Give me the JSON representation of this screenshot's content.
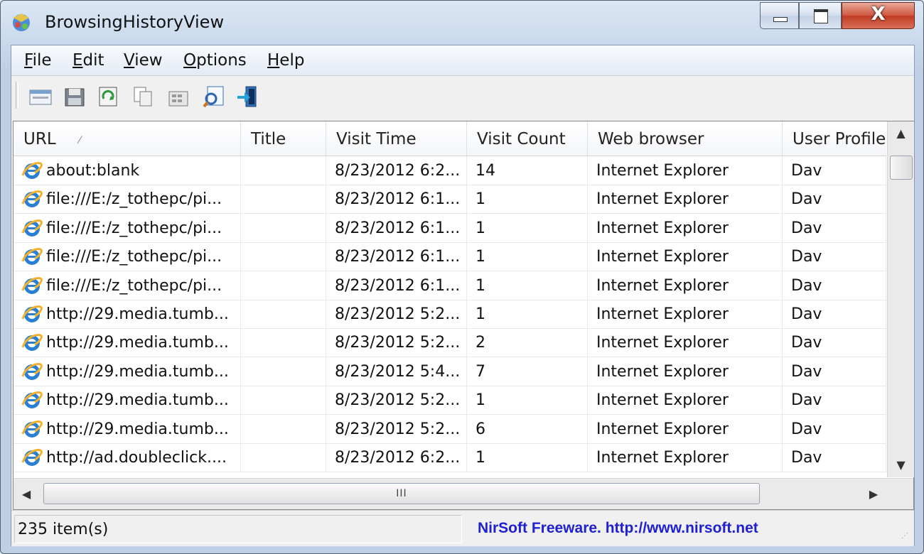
{
  "window": {
    "title": "BrowsingHistoryView",
    "controls": {
      "minimize": "minimize",
      "maximize": "maximize",
      "close": "X"
    }
  },
  "menu": [
    {
      "label": "File",
      "accel": "F",
      "rest": "ile"
    },
    {
      "label": "Edit",
      "accel": "E",
      "rest": "dit"
    },
    {
      "label": "View",
      "accel": "V",
      "rest": "iew"
    },
    {
      "label": "Options",
      "accel": "O",
      "rest": "ptions"
    },
    {
      "label": "Help",
      "accel": "H",
      "rest": "elp"
    }
  ],
  "toolbar": {
    "buttons": [
      {
        "icon": "advanced-options-icon"
      },
      {
        "icon": "save-icon"
      },
      {
        "icon": "refresh-icon"
      },
      {
        "icon": "copy-icon"
      },
      {
        "icon": "properties-icon"
      },
      {
        "icon": "find-icon"
      },
      {
        "icon": "exit-icon"
      }
    ]
  },
  "columns": [
    "URL",
    "Title",
    "Visit Time",
    "Visit Count",
    "Web browser",
    "User Profile"
  ],
  "rows": [
    {
      "url": "about:blank",
      "title": "",
      "visit_time": "8/23/2012 6:2...",
      "visit_count": "14",
      "browser": "Internet Explorer",
      "profile": "Dav"
    },
    {
      "url": "file:///E:/z_tothepc/pi...",
      "title": "",
      "visit_time": "8/23/2012 6:1...",
      "visit_count": "1",
      "browser": "Internet Explorer",
      "profile": "Dav"
    },
    {
      "url": "file:///E:/z_tothepc/pi...",
      "title": "",
      "visit_time": "8/23/2012 6:1...",
      "visit_count": "1",
      "browser": "Internet Explorer",
      "profile": "Dav"
    },
    {
      "url": "file:///E:/z_tothepc/pi...",
      "title": "",
      "visit_time": "8/23/2012 6:1...",
      "visit_count": "1",
      "browser": "Internet Explorer",
      "profile": "Dav"
    },
    {
      "url": "file:///E:/z_tothepc/pi...",
      "title": "",
      "visit_time": "8/23/2012 6:1...",
      "visit_count": "1",
      "browser": "Internet Explorer",
      "profile": "Dav"
    },
    {
      "url": "http://29.media.tumb...",
      "title": "",
      "visit_time": "8/23/2012 5:2...",
      "visit_count": "1",
      "browser": "Internet Explorer",
      "profile": "Dav"
    },
    {
      "url": "http://29.media.tumb...",
      "title": "",
      "visit_time": "8/23/2012 5:2...",
      "visit_count": "2",
      "browser": "Internet Explorer",
      "profile": "Dav"
    },
    {
      "url": "http://29.media.tumb...",
      "title": "",
      "visit_time": "8/23/2012 5:4...",
      "visit_count": "7",
      "browser": "Internet Explorer",
      "profile": "Dav"
    },
    {
      "url": "http://29.media.tumb...",
      "title": "",
      "visit_time": "8/23/2012 5:2...",
      "visit_count": "1",
      "browser": "Internet Explorer",
      "profile": "Dav"
    },
    {
      "url": "http://29.media.tumb...",
      "title": "",
      "visit_time": "8/23/2012 5:2...",
      "visit_count": "6",
      "browser": "Internet Explorer",
      "profile": "Dav"
    },
    {
      "url": "http://ad.doubleclick....",
      "title": "",
      "visit_time": "8/23/2012 6:2...",
      "visit_count": "1",
      "browser": "Internet Explorer",
      "profile": "Dav"
    }
  ],
  "hscroll_grip": "III",
  "status": {
    "items": "235 item(s)",
    "credit": "NirSoft Freeware.  http://www.nirsoft.net"
  }
}
